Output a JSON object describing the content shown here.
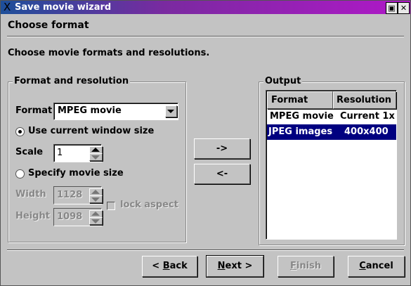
{
  "window": {
    "title": "Save movie wizard",
    "maximize_icon": "maximize-icon",
    "close_icon": "close-icon"
  },
  "header": {
    "title": "Choose format"
  },
  "description": "Choose movie formats and resolutions.",
  "format_group": {
    "title": "Format and resolution",
    "format_label": "Format",
    "format_value": "MPEG movie",
    "radio_current": "Use current window size",
    "radio_current_checked": true,
    "scale_label": "Scale",
    "scale_value": "1",
    "radio_specify": "Specify movie size",
    "radio_specify_checked": false,
    "width_label": "Width",
    "width_value": "1128",
    "height_label": "Height",
    "height_value": "1098",
    "lock_label": "lock aspect",
    "lock_checked": false
  },
  "move": {
    "add": "->",
    "remove": "<-"
  },
  "output": {
    "title": "Output",
    "columns": [
      "Format",
      "Resolution"
    ],
    "rows": [
      {
        "format": "MPEG movie",
        "resolution": "Current 1x",
        "selected": false
      },
      {
        "format": "JPEG images",
        "resolution": "400x400",
        "selected": true
      }
    ],
    "selection_color": "#000080"
  },
  "buttons": {
    "back_u": "B",
    "back_pre": "< ",
    "back_rest": "ack",
    "next_u": "N",
    "next_rest": "ext >",
    "finish_u": "F",
    "finish_rest": "inish",
    "cancel_u": "C",
    "cancel_rest": "ancel"
  }
}
